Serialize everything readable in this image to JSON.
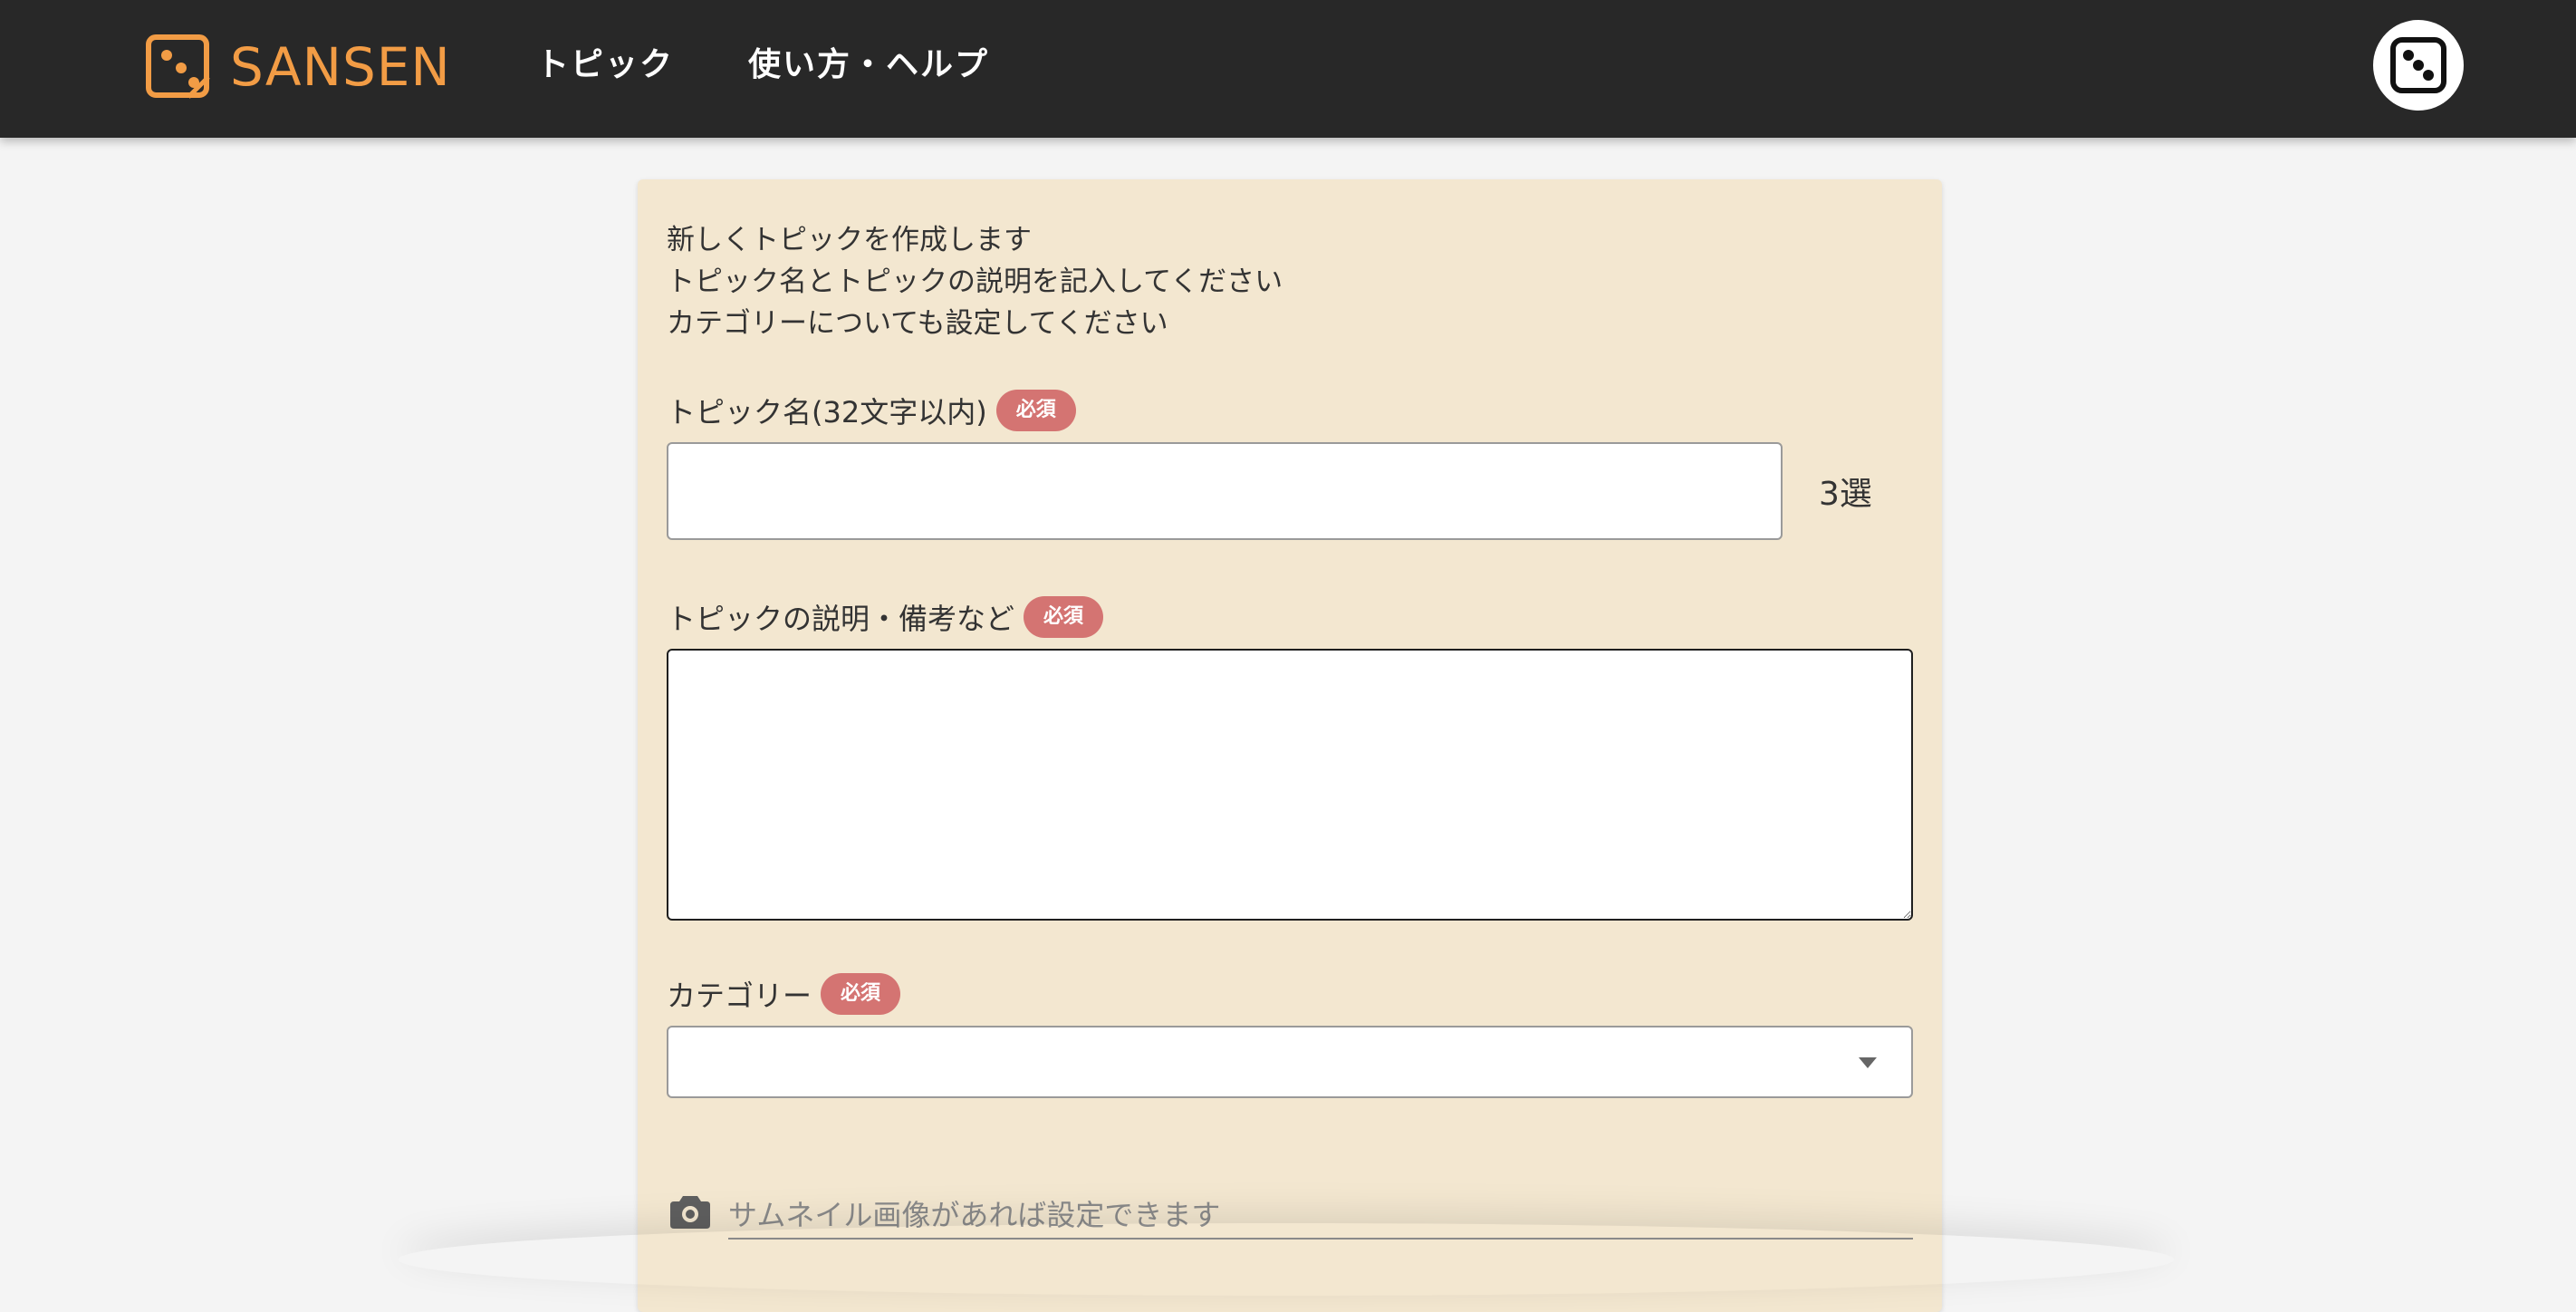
{
  "header": {
    "brand": "SANSEN",
    "brand_color": "#f29c45",
    "background": "#282828",
    "nav": [
      {
        "label": "トピック"
      },
      {
        "label": "使い方・ヘルプ"
      }
    ],
    "logo_icon": "dice-logo-icon",
    "avatar_icon": "dice-avatar-icon"
  },
  "form": {
    "background": "#f3e7d0",
    "intro": [
      "新しくトピックを作成します",
      "トピック名とトピックの説明を記入してください",
      "カテゴリーについても設定してください"
    ],
    "badge_color": "#d47472",
    "title_field": {
      "label": "トピック名(32文字以内)",
      "badge": "必須",
      "value": "",
      "count_text": "3選"
    },
    "description_field": {
      "label": "トピックの説明・備考など",
      "badge": "必須",
      "value": ""
    },
    "category_field": {
      "label": "カテゴリー",
      "badge": "必須",
      "selected": ""
    },
    "thumbnail_field": {
      "placeholder": "サムネイル画像があれば設定できます",
      "icon": "camera-icon"
    }
  }
}
